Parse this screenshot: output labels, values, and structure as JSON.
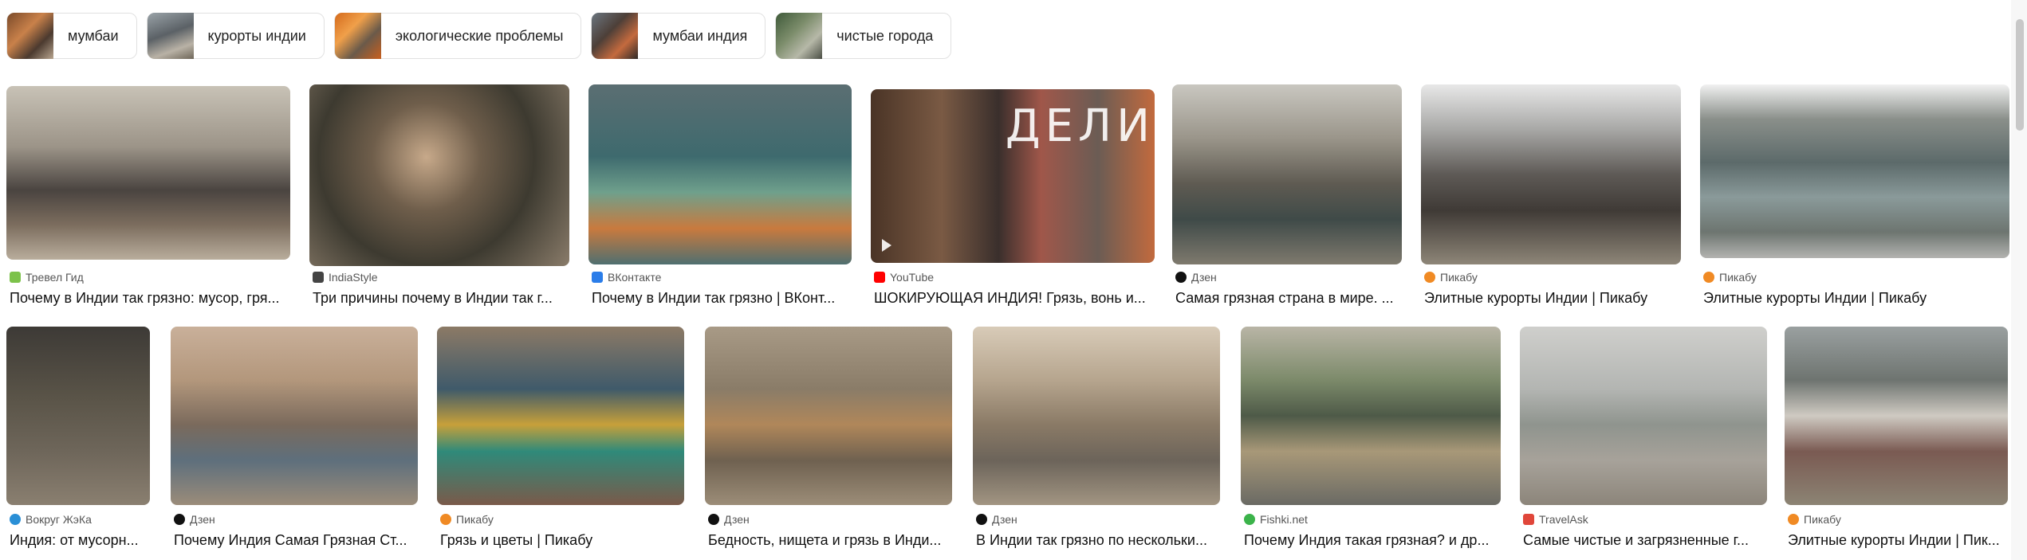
{
  "chips": [
    {
      "label": "мумбаи"
    },
    {
      "label": "курорты индии"
    },
    {
      "label": "экологические проблемы"
    },
    {
      "label": "мумбаи индия"
    },
    {
      "label": "чистые города"
    }
  ],
  "row1": [
    {
      "source": "Тревел Гид",
      "title": "Почему в Индии так грязно: мусор, гря..."
    },
    {
      "source": "IndiaStyle",
      "title": "Три причины почему в Индии так г..."
    },
    {
      "source": "ВКонтакте",
      "title": "Почему в Индии так грязно | ВКонт..."
    },
    {
      "source": "YouTube",
      "title": "ШОКИРУЮЩАЯ ИНДИЯ! Грязь, вонь и...",
      "overlay": "ДЕЛИ"
    },
    {
      "source": "Дзен",
      "title": "Самая грязная страна в мире. ..."
    },
    {
      "source": "Пикабу",
      "title": "Элитные курорты Индии | Пикабу"
    },
    {
      "source": "Пикабу",
      "title": "Элитные курорты Индии | Пикабу"
    }
  ],
  "row2": [
    {
      "source": "Вокруг ЖэКа",
      "title": "Индия: от мусорн..."
    },
    {
      "source": "Дзен",
      "title": "Почему Индия Самая Грязная Ст..."
    },
    {
      "source": "Пикабу",
      "title": "Грязь и цветы | Пикабу"
    },
    {
      "source": "Дзен",
      "title": "Бедность, нищета и грязь в Инди..."
    },
    {
      "source": "Дзен",
      "title": "В Индии так грязно по нескольки..."
    },
    {
      "source": "Fishki.net",
      "title": "Почему Индия такая грязная? и др..."
    },
    {
      "source": "TravelAsk",
      "title": "Самые чистые и загрязненные г..."
    },
    {
      "source": "Пикабу",
      "title": "Элитные курорты Индии | Пик..."
    }
  ]
}
